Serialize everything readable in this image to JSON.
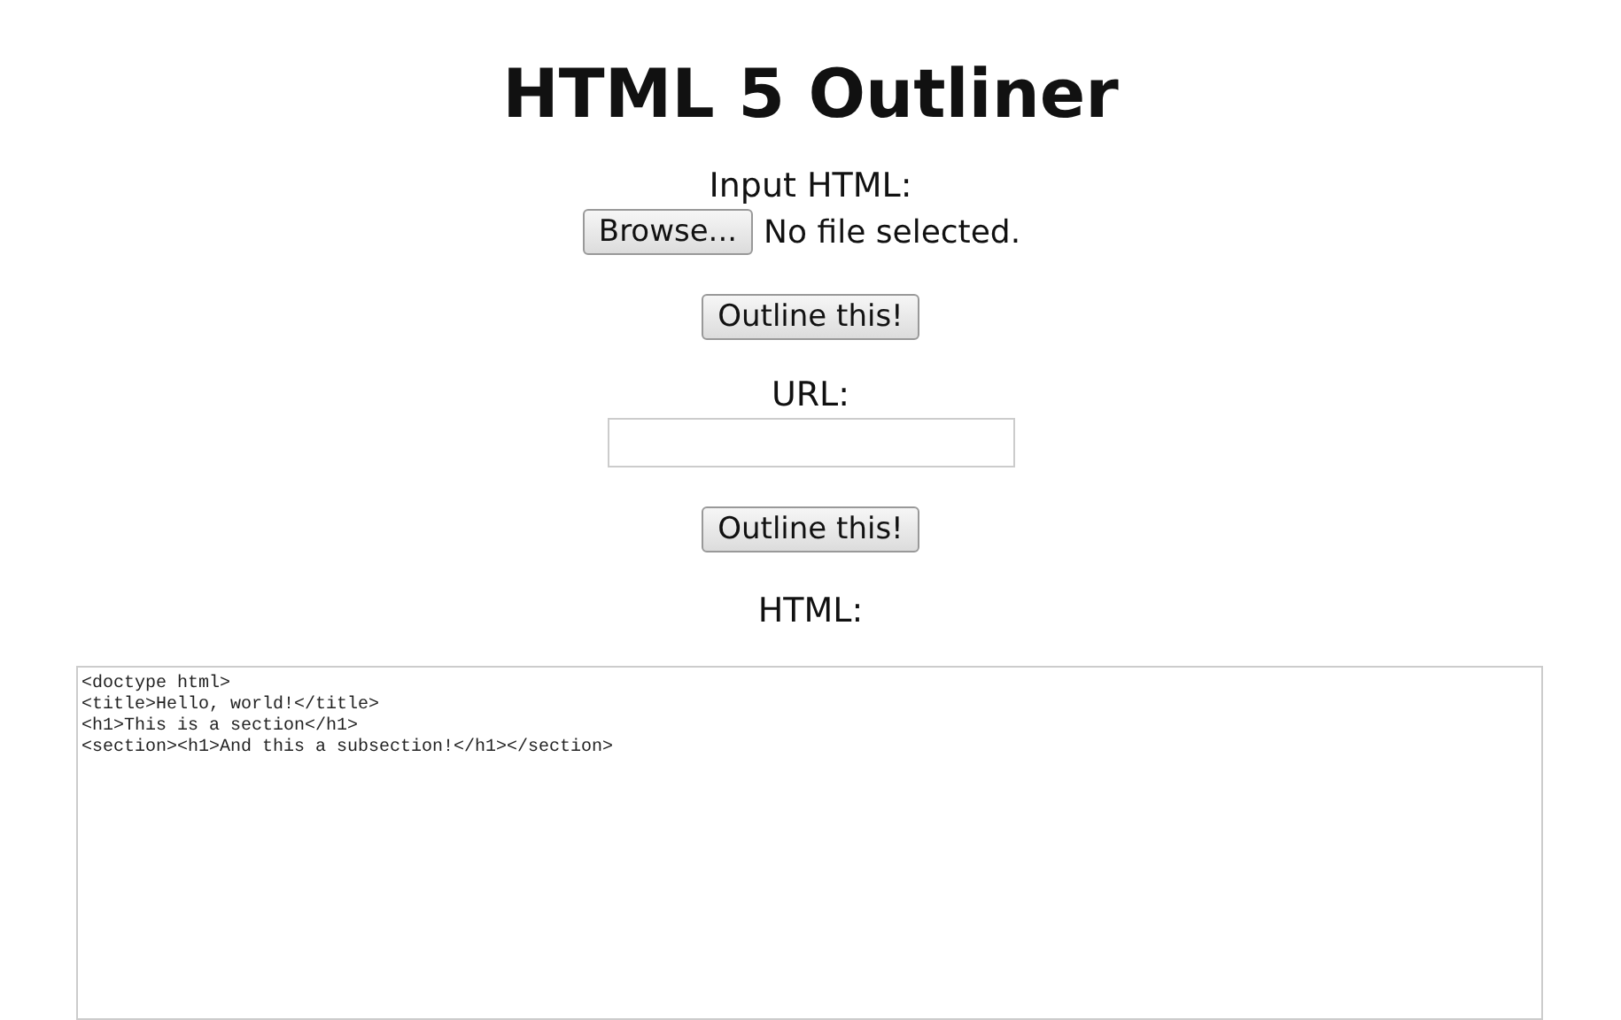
{
  "title": "HTML 5 Outliner",
  "file_section": {
    "label": "Input HTML:",
    "browse_button": "Browse...",
    "file_status": "No file selected.",
    "submit_button": "Outline this!"
  },
  "url_section": {
    "label": "URL:",
    "submit_button": "Outline this!"
  },
  "html_section": {
    "label": "HTML:",
    "lines": [
      "<doctype html>",
      "<title>Hello, world!</title>",
      "<h1>This is a section</h1>",
      "<section><h1>And this a subsection!</h1></section>"
    ]
  }
}
